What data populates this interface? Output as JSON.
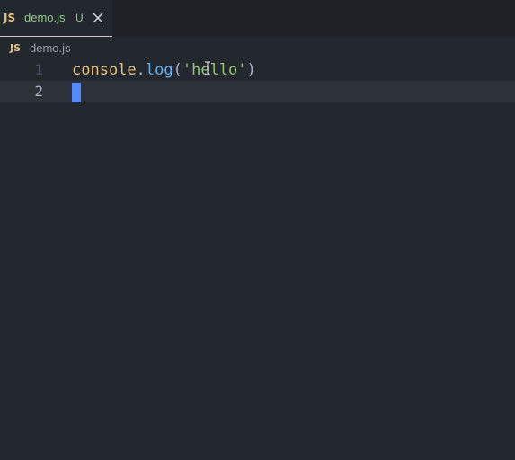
{
  "tab": {
    "icon": "JS",
    "label": "demo.js",
    "status": "U",
    "close_icon": "close-icon"
  },
  "breadcrumb": {
    "icon": "JS",
    "label": "demo.js"
  },
  "editor": {
    "lines": [
      {
        "number": "1",
        "tokens": {
          "object": "console",
          "dot": ".",
          "method": "log",
          "open_paren": "(",
          "string": "'hello'",
          "close_paren": ")"
        }
      },
      {
        "number": "2"
      }
    ]
  },
  "colors": {
    "accent_cursor": "#528bff",
    "untracked": "#8fc98d",
    "js_icon": "#e5c07b"
  }
}
